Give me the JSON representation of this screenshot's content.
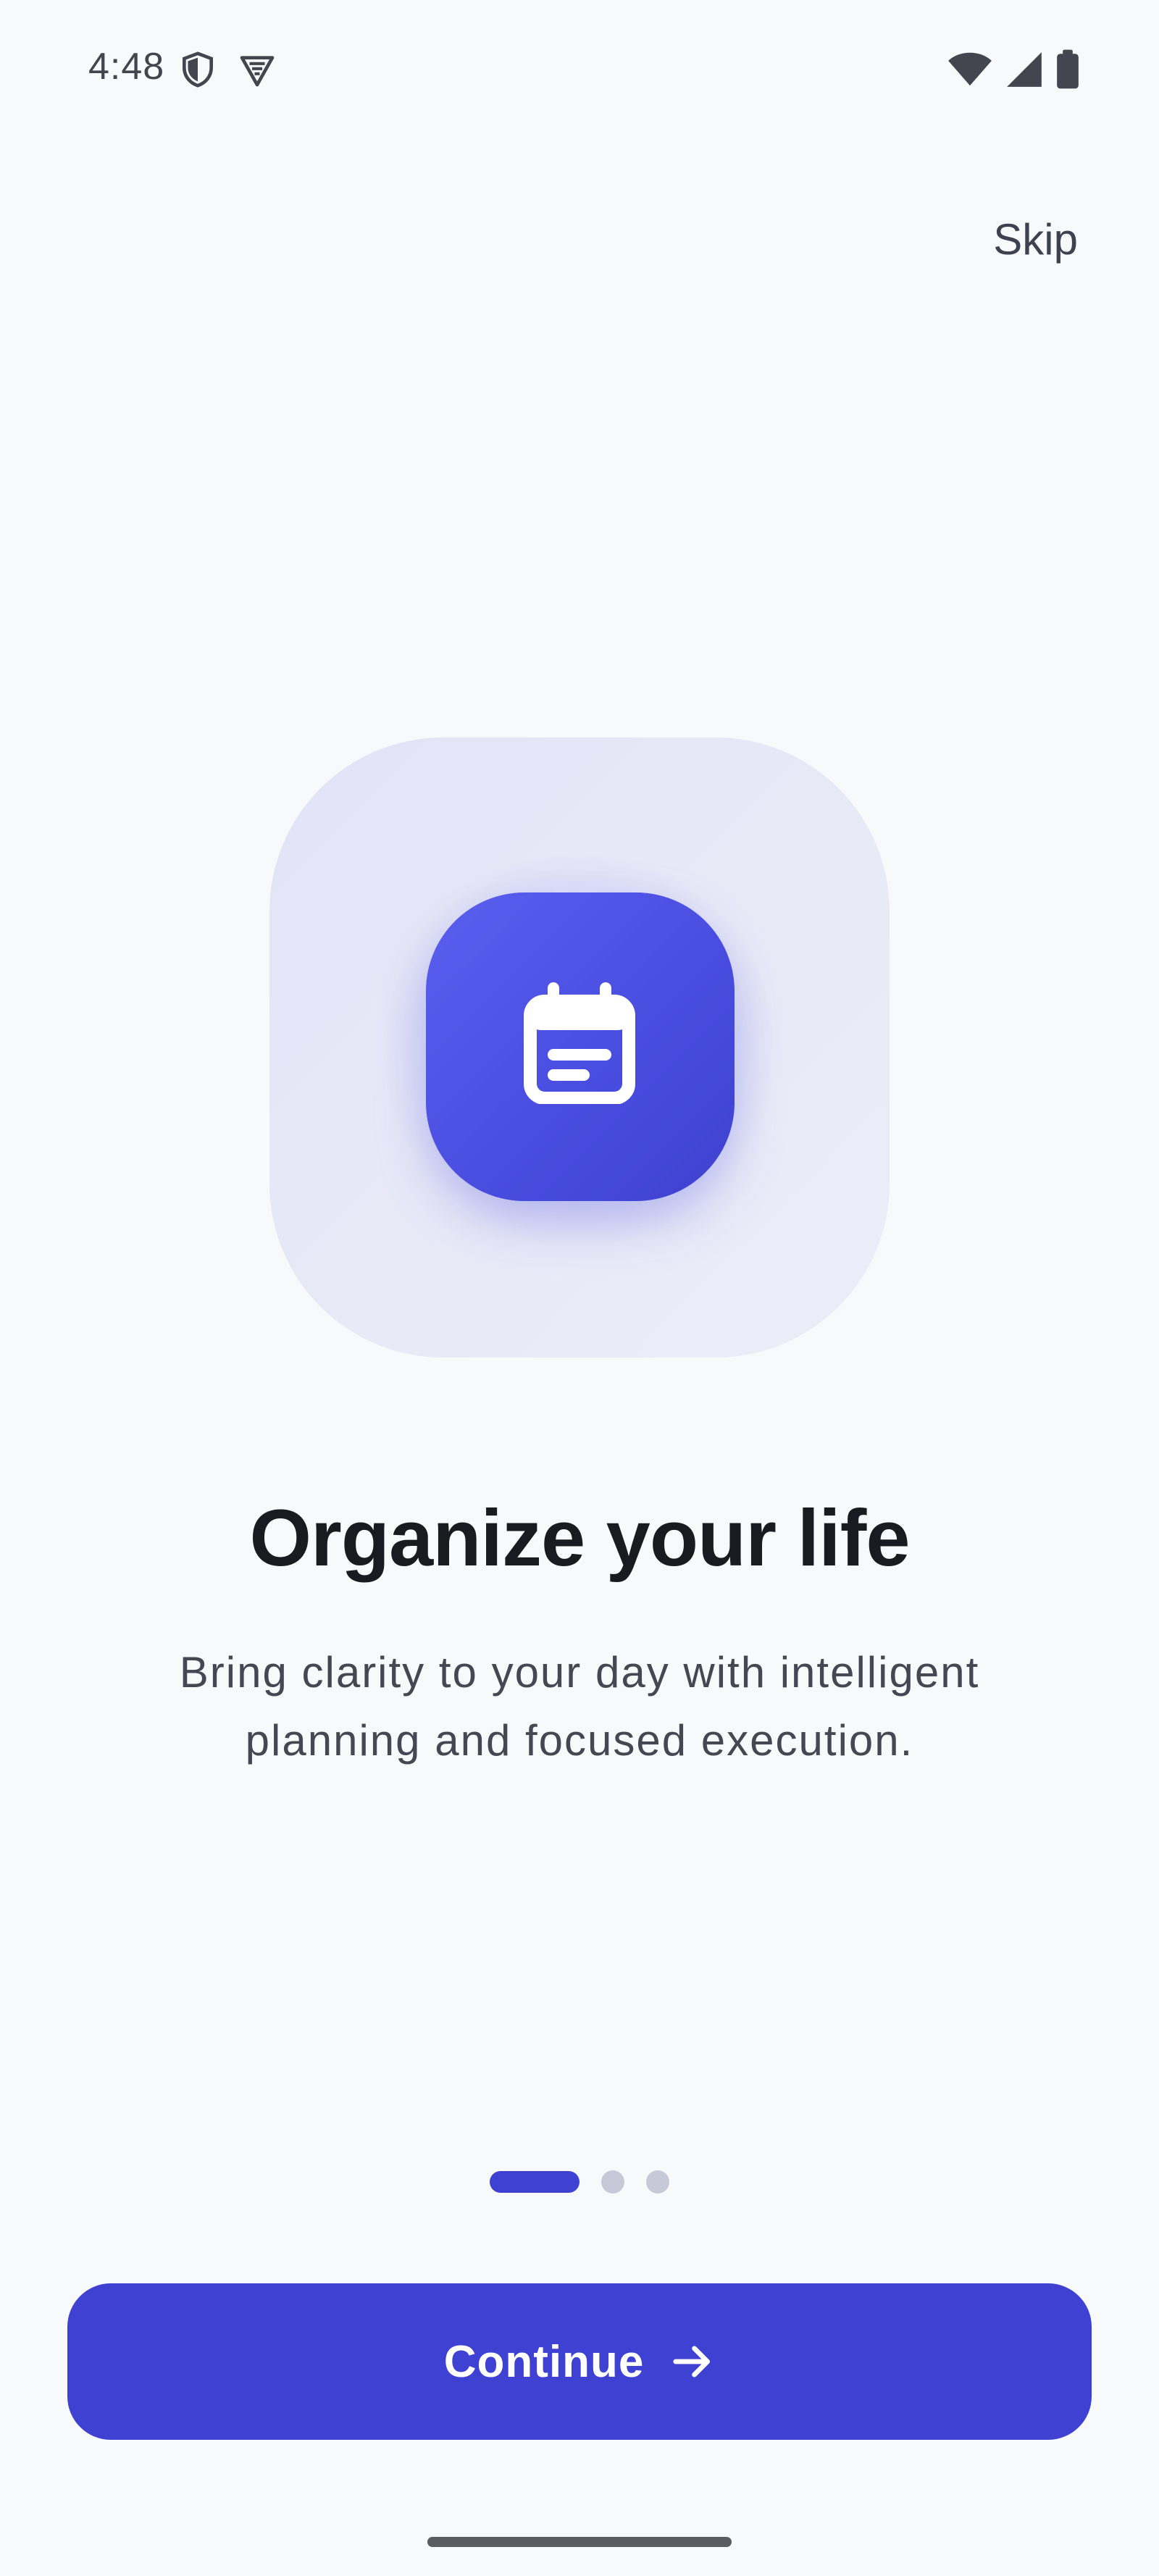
{
  "status_bar": {
    "time": "4:48",
    "left_icons": [
      "shield-icon",
      "vpn-badge-icon"
    ],
    "right_icons": [
      "wifi-icon",
      "signal-icon",
      "battery-icon"
    ]
  },
  "onboarding": {
    "skip_label": "Skip",
    "hero_icon": "calendar-notes-icon",
    "title": "Organize your life",
    "subtitle_line1": "Bring clarity to your day with intelligent",
    "subtitle_line2": "planning and focused execution.",
    "pager": {
      "current_page": 1,
      "total_pages": 3
    },
    "continue_label": "Continue",
    "continue_icon": "arrow-right-icon"
  },
  "colors": {
    "accent": "#3f41d3",
    "background": "#f8f9fb",
    "hero_tile": "#e4e5f7",
    "dot_inactive": "#c8c9d8"
  }
}
